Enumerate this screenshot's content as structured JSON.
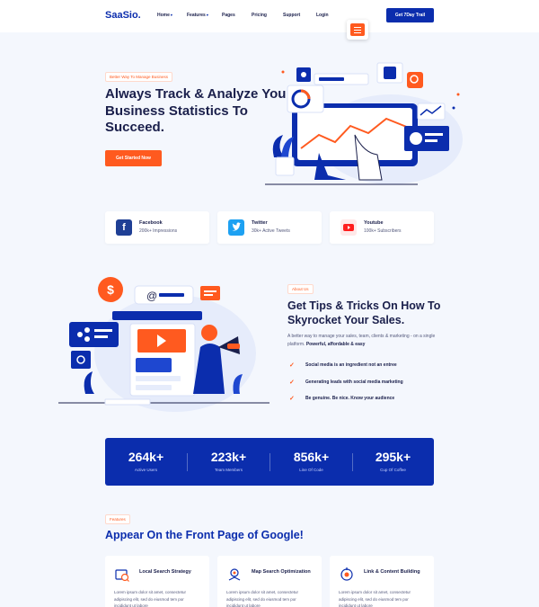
{
  "nav": {
    "logo": "SaaSio.",
    "items": [
      {
        "label": "Home",
        "dropdown": true
      },
      {
        "label": "Features",
        "dropdown": true
      },
      {
        "label": "Pages",
        "dropdown": false
      },
      {
        "label": "Pricing",
        "dropdown": false
      },
      {
        "label": "Support",
        "dropdown": false
      },
      {
        "label": "Login",
        "dropdown": false
      }
    ],
    "cta": "Get 7Day Trail",
    "menu_icon": "hamburger-menu-icon"
  },
  "hero": {
    "badge": "Better Way To Manage Business",
    "title": "Always Track & Analyze Your Business Statistics To Succeed.",
    "cta": "Get Started Now"
  },
  "social": [
    {
      "name": "Facebook",
      "stat": "200k+ Impressions",
      "icon": "facebook-icon",
      "color": "#1f3f95"
    },
    {
      "name": "Twitter",
      "stat": "30k+ Active Tweets",
      "icon": "twitter-icon",
      "color": "#1da1f2"
    },
    {
      "name": "Youtube",
      "stat": "100k+ Subscribers",
      "icon": "youtube-icon",
      "color": "#ff1d1d"
    }
  ],
  "tips": {
    "badge": "About Us",
    "title": "Get Tips & Tricks On How To Skyrocket Your Sales.",
    "desc": "A better way to manage your sales, team, clients & marketing - on a single platform.",
    "desc_bold": "Powerful, affordable & easy",
    "checks": [
      "Social media is an ingredient not an entree",
      "Generating leads with social media marketing",
      "Be genuine. Be nice. Know your audience"
    ]
  },
  "stats": [
    {
      "num": "264k+",
      "label": "Active Users"
    },
    {
      "num": "223k+",
      "label": "Team Members"
    },
    {
      "num": "856k+",
      "label": "Line Of Code"
    },
    {
      "num": "295k+",
      "label": "Cup Of Coffee"
    }
  ],
  "features": {
    "badge": "Features",
    "title": "Appear On the Front Page of Google!",
    "items": [
      {
        "title": "Local Search Strategy",
        "desc": "Lorem ipsum dolor sit amet, consectetur adipiscing elit, sed do eiusmod tem por incididunt ut labore",
        "icon": "local-search-icon"
      },
      {
        "title": "Map Search Optimization",
        "desc": "Lorem ipsum dolor sit amet, consectetur adipiscing elit, sed do eiusmod tem por incididunt ut labore",
        "icon": "map-search-icon"
      },
      {
        "title": "Link & Content Building",
        "desc": "Lorem ipsum dolor sit amet, consectetur adipiscing elit, sed do eiusmod tem por incididunt ut labore",
        "icon": "link-content-icon"
      }
    ]
  },
  "colors": {
    "primary": "#0b2dad",
    "accent": "#ff5a1f",
    "dark": "#1a1f4b",
    "bg": "#f4f7fd"
  }
}
